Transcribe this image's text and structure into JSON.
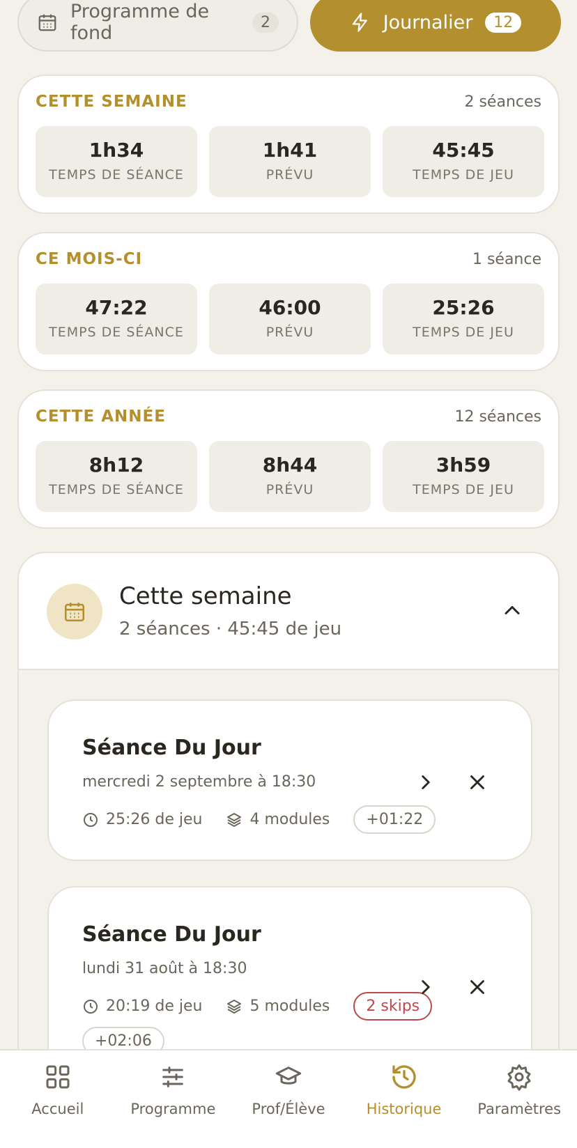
{
  "toggle": {
    "background": {
      "label": "Programme de fond",
      "count": "2"
    },
    "daily": {
      "label": "Journalier",
      "count": "12"
    }
  },
  "stats": [
    {
      "title": "CETTE SEMAINE",
      "sessions": "2 séances",
      "cells": [
        {
          "value": "1h34",
          "label": "TEMPS DE SÉANCE"
        },
        {
          "value": "1h41",
          "label": "PRÉVU"
        },
        {
          "value": "45:45",
          "label": "TEMPS DE JEU"
        }
      ]
    },
    {
      "title": "CE MOIS-CI",
      "sessions": "1 séance",
      "cells": [
        {
          "value": "47:22",
          "label": "TEMPS DE SÉANCE"
        },
        {
          "value": "46:00",
          "label": "PRÉVU"
        },
        {
          "value": "25:26",
          "label": "TEMPS DE JEU"
        }
      ]
    },
    {
      "title": "CETTE ANNÉE",
      "sessions": "12 séances",
      "cells": [
        {
          "value": "8h12",
          "label": "TEMPS DE SÉANCE"
        },
        {
          "value": "8h44",
          "label": "PRÉVU"
        },
        {
          "value": "3h59",
          "label": "TEMPS DE JEU"
        }
      ]
    }
  ],
  "week_group": {
    "title": "Cette semaine",
    "subtitle": "2 séances · 45:45 de jeu"
  },
  "sessions": [
    {
      "title": "Séance Du Jour",
      "date": "mercredi 2 septembre à 18:30",
      "play": "25:26 de jeu",
      "modules": "4 modules",
      "badge": "+01:22"
    },
    {
      "title": "Séance Du Jour",
      "date": "lundi 31 août à 18:30",
      "play": "20:19 de jeu",
      "modules": "5 modules",
      "skips": "2 skips",
      "badge": "+02:06"
    }
  ],
  "nav": [
    {
      "label": "Accueil",
      "icon": "grid-icon"
    },
    {
      "label": "Programme",
      "icon": "sliders-icon"
    },
    {
      "label": "Prof/Élève",
      "icon": "graduation-cap-icon"
    },
    {
      "label": "Historique",
      "icon": "history-icon",
      "active": true
    },
    {
      "label": "Paramètres",
      "icon": "gear-icon"
    }
  ],
  "colors": {
    "accent": "#b38f2e",
    "background": "#f3f1ea",
    "danger": "#c04848"
  }
}
